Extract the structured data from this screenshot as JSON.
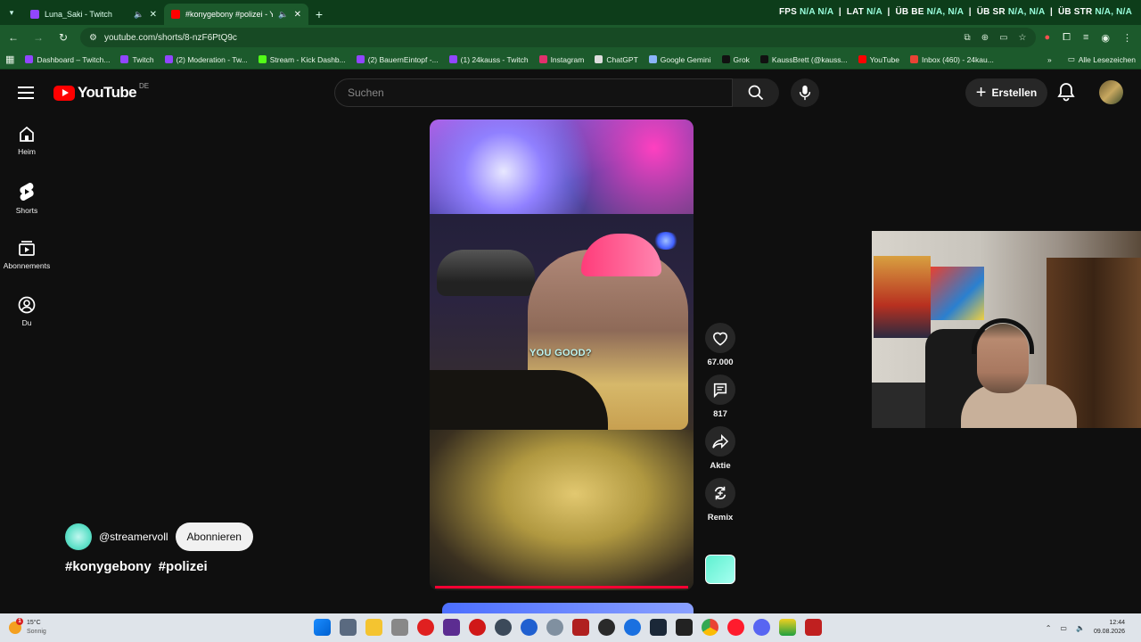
{
  "browser": {
    "tabs": [
      {
        "title": "Luna_Saki - Twitch",
        "favicon_color": "#9146ff",
        "active": false
      },
      {
        "title": "#konygebony #polizei - Yo",
        "favicon_color": "#ff0000",
        "active": true
      }
    ],
    "stats": [
      {
        "label": "FPS",
        "value": "N/A"
      },
      {
        "label": "",
        "value": "N/A"
      },
      {
        "label": "LAT",
        "value": "N/A"
      },
      {
        "label": "ÜB BE",
        "value": "N/A, N/A"
      },
      {
        "label": "ÜB SR",
        "value": "N/A, N/A"
      },
      {
        "label": "ÜB STR",
        "value": "N/A, N/A"
      }
    ],
    "url": "youtube.com/shorts/8-nzF6PtQ9c",
    "bookmarks": [
      {
        "label": "Dashboard – Twitch...",
        "color": "#9146ff"
      },
      {
        "label": "Twitch",
        "color": "#9146ff"
      },
      {
        "label": "(2) Moderation - Tw...",
        "color": "#9146ff"
      },
      {
        "label": "Stream - Kick Dashb...",
        "color": "#53fc18"
      },
      {
        "label": "(2) BauernEintopf -...",
        "color": "#9146ff"
      },
      {
        "label": "(1) 24kauss - Twitch",
        "color": "#9146ff"
      },
      {
        "label": "Instagram",
        "color": "#e1306c"
      },
      {
        "label": "ChatGPT",
        "color": "#dddddd"
      },
      {
        "label": "Google Gemini",
        "color": "#8ab4f8"
      },
      {
        "label": "Grok",
        "color": "#111111"
      },
      {
        "label": "KaussBrett (@kauss...",
        "color": "#111111"
      },
      {
        "label": "YouTube",
        "color": "#ff0000"
      },
      {
        "label": "Inbox (460) - 24kau...",
        "color": "#ea4335"
      }
    ],
    "all_bookmarks": "Alle Lesezeichen"
  },
  "youtube": {
    "wordmark": "YouTube",
    "country": "DE",
    "search_placeholder": "Suchen",
    "create_label": "Erstellen",
    "nav": [
      {
        "label": "Heim",
        "icon": "home-icon"
      },
      {
        "label": "Shorts",
        "icon": "shorts-icon"
      },
      {
        "label": "Abonnements",
        "icon": "subscriptions-icon"
      },
      {
        "label": "Du",
        "icon": "you-icon"
      }
    ],
    "video": {
      "caption": "YOU GOOD?",
      "progress": 0.98
    },
    "actions": {
      "likes": "67.000",
      "comments": "817",
      "share": "Aktie",
      "remix": "Remix"
    },
    "channel": {
      "handle": "@streamervoll",
      "subscribe_label": "Abonnieren"
    },
    "hashtags": [
      "#konygebony",
      "#polizei"
    ]
  },
  "taskbar": {
    "weather_temp": "15°C",
    "weather_desc": "Sonnig",
    "weather_badge": "1",
    "time": "12:44",
    "date": "09.08.2026"
  }
}
